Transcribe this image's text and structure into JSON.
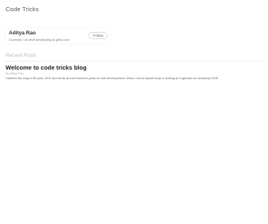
{
  "site": {
    "title": "Code Tricks"
  },
  "author": {
    "name": "Aditya Rao",
    "bio": "Currently I do stuff developing at githo.com",
    "follow_label": "Follow"
  },
  "recent_posts": {
    "heading": "Recent Posts",
    "items": [
      {
        "title": "Welcome to code tricks blog",
        "meta": "By Aditya Rao",
        "excerpt": "I started this blog in the year 2012 and wrote around hundred posts on web development. When I found myself busy in looking at Cognizant as Javascript SDE."
      }
    ]
  }
}
